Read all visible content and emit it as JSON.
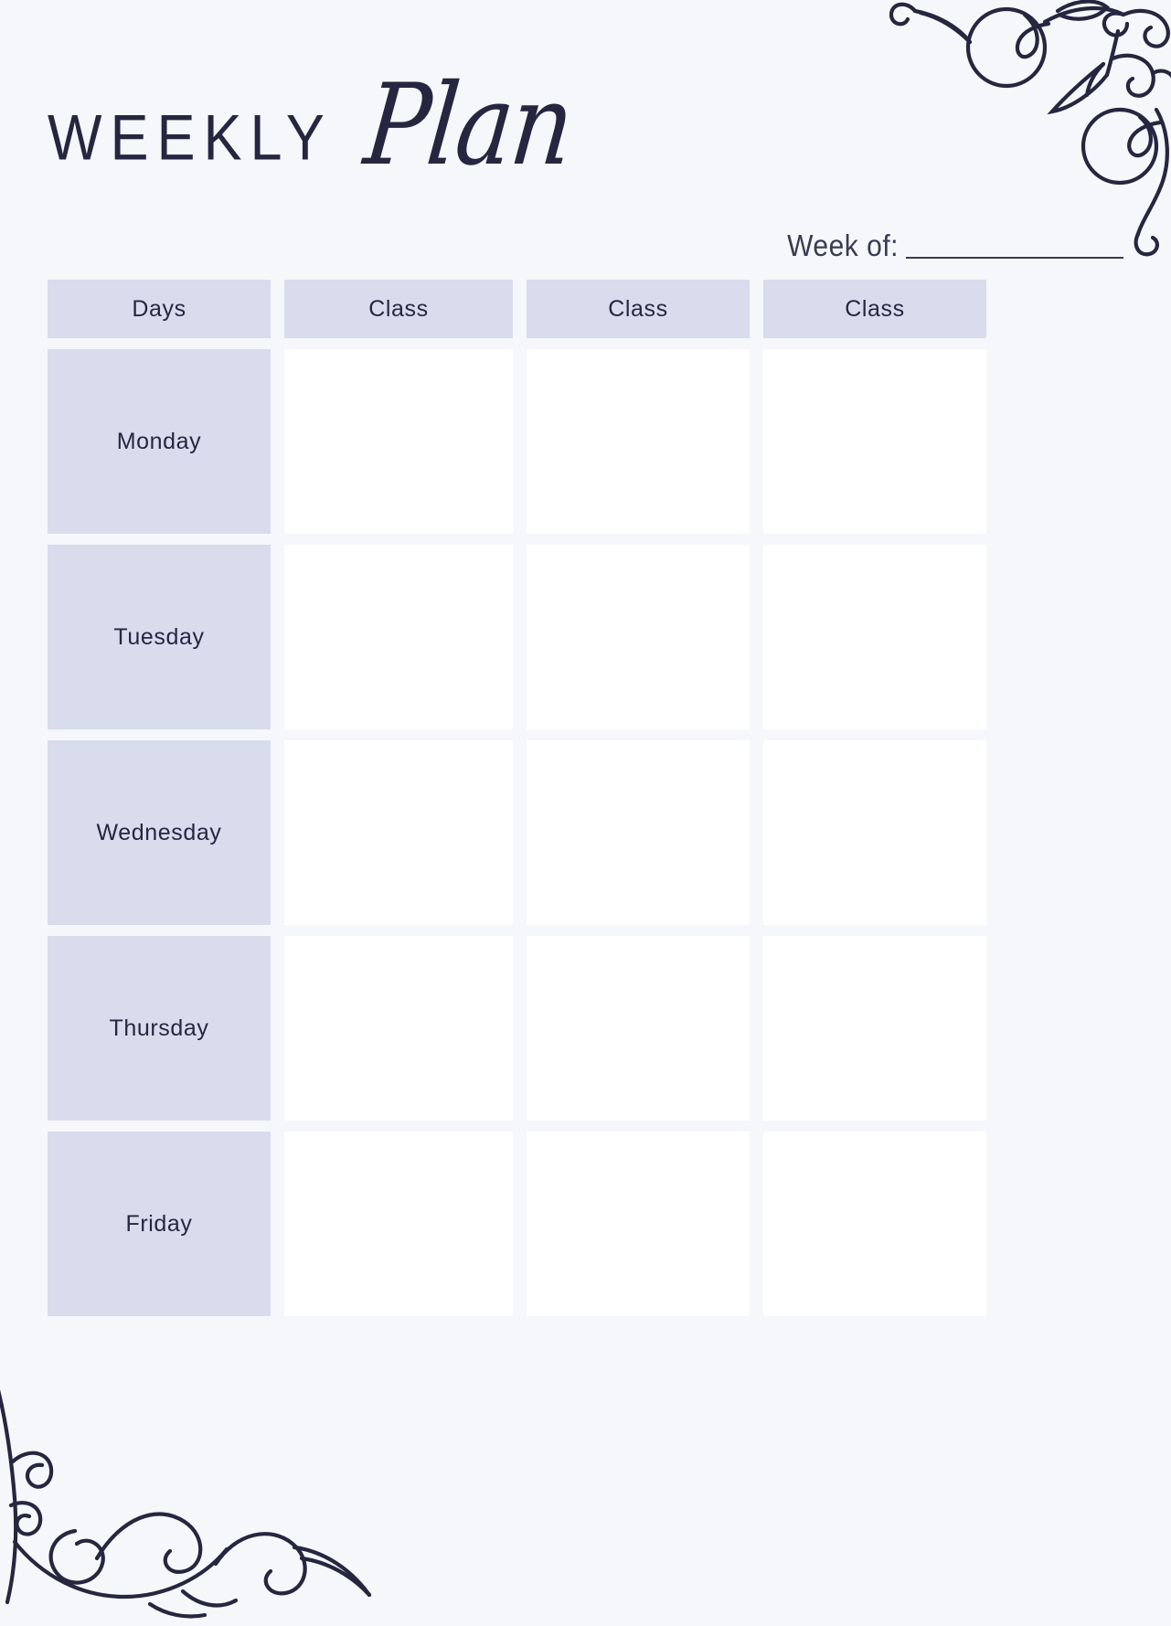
{
  "document": {
    "title_primary": "WEEKLY",
    "title_script": "Plan"
  },
  "week_of": {
    "label": "Week of:",
    "value": ""
  },
  "table": {
    "headers": [
      "Days",
      "Class",
      "Class",
      "Class"
    ],
    "rows": [
      {
        "day": "Monday",
        "classes": [
          "",
          "",
          ""
        ]
      },
      {
        "day": "Tuesday",
        "classes": [
          "",
          "",
          ""
        ]
      },
      {
        "day": "Wednesday",
        "classes": [
          "",
          "",
          ""
        ]
      },
      {
        "day": "Thursday",
        "classes": [
          "",
          "",
          ""
        ]
      },
      {
        "day": "Friday",
        "classes": [
          "",
          "",
          ""
        ]
      }
    ]
  },
  "theme": {
    "background": "#f5f7fa",
    "ink": "#262640",
    "cell_fill": "#d9dced",
    "class_fill": "#ffffff"
  },
  "ornaments": {
    "top_right": "swirl-flourish-icon",
    "bottom_left": "swirl-flourish-icon"
  }
}
